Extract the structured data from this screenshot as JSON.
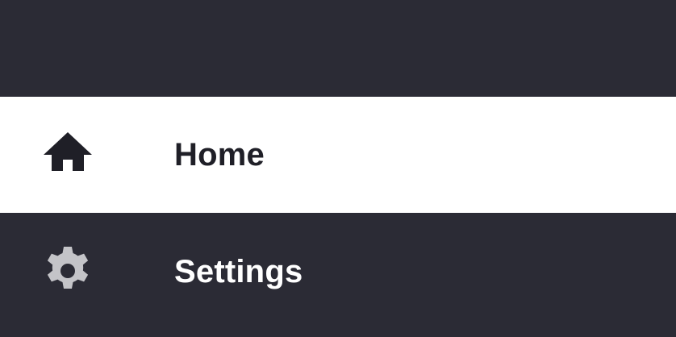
{
  "nav": {
    "items": [
      {
        "label": "Home",
        "icon": "home-icon",
        "selected": true
      },
      {
        "label": "Settings",
        "icon": "gear-icon",
        "selected": false
      }
    ]
  },
  "colors": {
    "drawer_bg": "#2b2b35",
    "selected_bg": "#ffffff",
    "selected_text": "#1f1f27",
    "unselected_text": "#ffffff",
    "unselected_icon": "#c4c4c8"
  }
}
